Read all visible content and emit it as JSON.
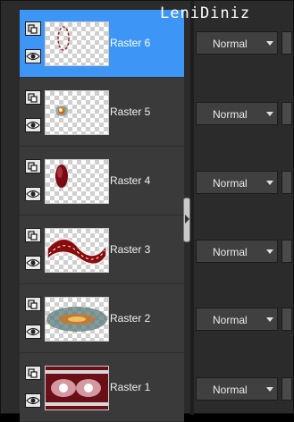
{
  "watermark": "LeniDiniz",
  "layers": [
    {
      "name": "Raster 6",
      "blend_mode": "Normal",
      "selected": true
    },
    {
      "name": "Raster 5",
      "blend_mode": "Normal",
      "selected": false
    },
    {
      "name": "Raster 4",
      "blend_mode": "Normal",
      "selected": false
    },
    {
      "name": "Raster 3",
      "blend_mode": "Normal",
      "selected": false
    },
    {
      "name": "Raster 2",
      "blend_mode": "Normal",
      "selected": false
    },
    {
      "name": "Raster 1",
      "blend_mode": "Normal",
      "selected": false
    }
  ],
  "colors": {
    "selected_row": "#3d96f5",
    "panel_bg": "#3a3a3a",
    "control_bg": "#404040"
  },
  "icons": {
    "lock": "lock-icon",
    "visibility": "eye-icon",
    "dropdown": "chevron-down-icon",
    "splitter": "chevron-right-icon"
  }
}
